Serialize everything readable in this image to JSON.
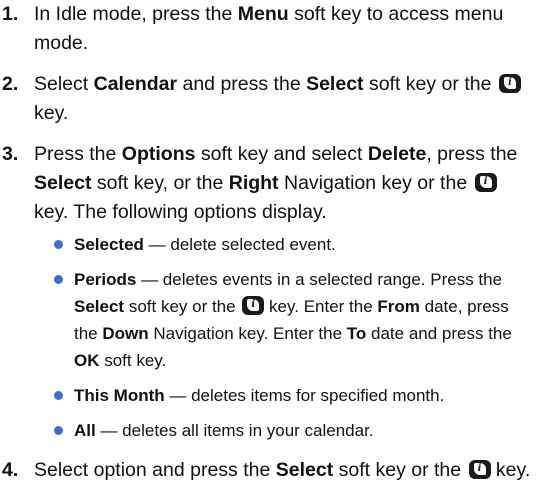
{
  "steps": [
    {
      "num": "1.",
      "p1": "In Idle mode, press the ",
      "b1": "Menu",
      "p2": " soft key to access menu mode."
    },
    {
      "num": "2.",
      "p1": "Select ",
      "b1": "Calendar",
      "p2": " and press the ",
      "b2": "Select",
      "p3": " soft key or the ",
      "p4": " key."
    },
    {
      "num": "3.",
      "p1": "Press the ",
      "b1": "Options",
      "p2": " soft key and select ",
      "b2": "Delete",
      "p3": ", press the ",
      "b3": "Select",
      "p4": " soft key, or the ",
      "b4": "Right",
      "p5": " Navigation key or the ",
      "p6": " key. The following options display."
    },
    {
      "num": "4.",
      "p1": "Select option and press the ",
      "b1": "Select",
      "p2": " soft key or the ",
      "p3": " key."
    }
  ],
  "options": [
    {
      "b1": "Selected",
      "p1": " — delete selected event."
    },
    {
      "b1": "Periods",
      "p1": " — deletes events in a selected range. Press the ",
      "b2": "Select",
      "p2": " soft key or the ",
      "p3": " key. Enter the ",
      "b3": "From",
      "p4": " date, press the ",
      "b4": "Down",
      "p5": " Navigation key. Enter the ",
      "b5": "To",
      "p6": " date and press the ",
      "b6": "OK",
      "p7": " soft key."
    },
    {
      "b1": "This Month",
      "p1": " — deletes items for specified month."
    },
    {
      "b1": "All",
      "p1": " — deletes all items in your calendar."
    }
  ],
  "icons": {
    "info_key": "info-key-icon"
  },
  "colors": {
    "bullet": "#3a6fd0",
    "key_icon": "#1a1a1a"
  }
}
